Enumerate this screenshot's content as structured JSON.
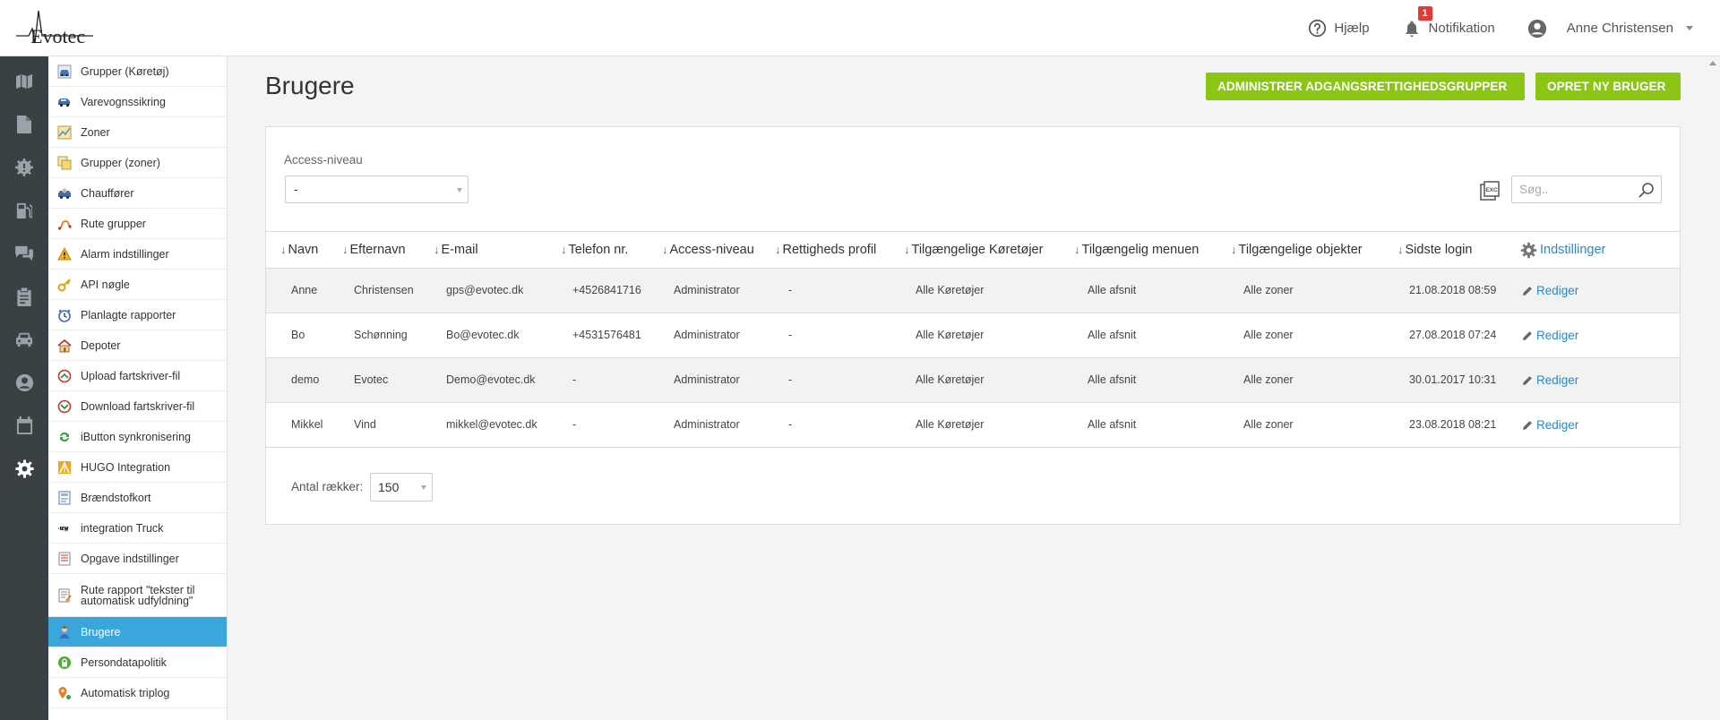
{
  "brand": {
    "logo_text": "Evotec"
  },
  "header": {
    "help_label": "Hjælp",
    "notification_label": "Notifikation",
    "notification_count": "1",
    "user_name": "Anne Christensen"
  },
  "submenu": {
    "items": [
      {
        "label": "Grupper (Køretøj)",
        "icon": "vehicle-group-icon"
      },
      {
        "label": "Varevognssikring",
        "icon": "van-icon"
      },
      {
        "label": "Zoner",
        "icon": "map-zone-icon"
      },
      {
        "label": "Grupper (zoner)",
        "icon": "zone-group-icon"
      },
      {
        "label": "Chauffører",
        "icon": "driver-icon"
      },
      {
        "label": "Rute grupper",
        "icon": "route-icon"
      },
      {
        "label": "Alarm indstillinger",
        "icon": "warning-icon"
      },
      {
        "label": "API nøgle",
        "icon": "key-icon"
      },
      {
        "label": "Planlagte rapporter",
        "icon": "clock-icon"
      },
      {
        "label": "Depoter",
        "icon": "house-icon"
      },
      {
        "label": "Upload fartskriver-fil",
        "icon": "tachograph-upload-icon"
      },
      {
        "label": "Download fartskriver-fil",
        "icon": "tachograph-download-icon"
      },
      {
        "label": "iButton synkronisering",
        "icon": "sync-icon"
      },
      {
        "label": "HUGO Integration",
        "icon": "hugo-icon"
      },
      {
        "label": "Brændstofkort",
        "icon": "fuel-card-icon"
      },
      {
        "label": "integration Truck",
        "icon": "ikw-logo-icon"
      },
      {
        "label": "Opgave indstillinger",
        "icon": "task-icon"
      },
      {
        "label": "Rute rapport \"tekster til automatisk udfyldning\"",
        "icon": "route-report-icon"
      },
      {
        "label": "Brugere",
        "icon": "user-icon"
      },
      {
        "label": "Persondatapolitik",
        "icon": "lock-icon"
      },
      {
        "label": "Automatisk triplog",
        "icon": "location-pin-icon"
      }
    ]
  },
  "page": {
    "title": "Brugere",
    "btn_admin": "ADMINISTRER ADGANGSRETTIGHEDSGRUPPER",
    "btn_new": "OPRET NY BRUGER"
  },
  "filter": {
    "label": "Access-niveau",
    "value": "-",
    "search_placeholder": "Søg.."
  },
  "table": {
    "columns": [
      "Navn",
      "Efternavn",
      "E-mail",
      "Telefon nr.",
      "Access-niveau",
      "Rettigheds profil",
      "Tilgængelige Køretøjer",
      "Tilgængelig menuen",
      "Tilgængelige objekter",
      "Sidste login",
      "Indstillinger"
    ],
    "edit_label": "Rediger",
    "rows": [
      [
        "Anne",
        "Christensen",
        "gps@evotec.dk",
        "+4526841716",
        "Administrator",
        "-",
        "Alle Køretøjer",
        "Alle afsnit",
        "Alle zoner",
        "21.08.2018 08:59"
      ],
      [
        "Bo",
        "Schønning",
        "Bo@evotec.dk",
        "+4531576481",
        "Administrator",
        "-",
        "Alle Køretøjer",
        "Alle afsnit",
        "Alle zoner",
        "27.08.2018 07:24"
      ],
      [
        "demo",
        "Evotec",
        "Demo@evotec.dk",
        "-",
        "Administrator",
        "-",
        "Alle Køretøjer",
        "Alle afsnit",
        "Alle zoner",
        "30.01.2017 10:31"
      ],
      [
        "Mikkel",
        "Vind",
        "mikkel@evotec.dk",
        "-",
        "Administrator",
        "-",
        "Alle Køretøjer",
        "Alle afsnit",
        "Alle zoner",
        "23.08.2018 08:21"
      ]
    ]
  },
  "pagination": {
    "rows_label": "Antal rækker:",
    "rows_value": "150"
  }
}
